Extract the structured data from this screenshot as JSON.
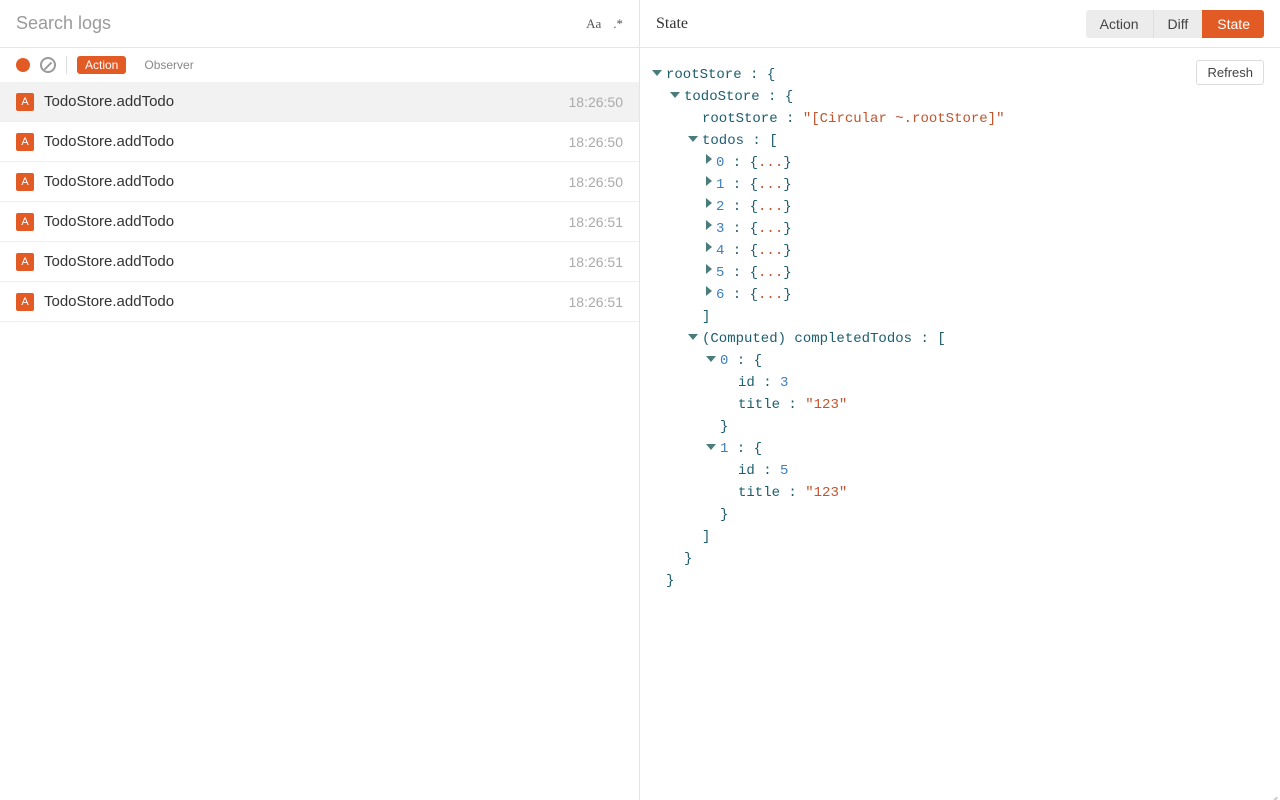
{
  "search": {
    "placeholder": "Search logs",
    "matchCaseLabel": "Aa",
    "regexLabel": ".*"
  },
  "filters": {
    "action": "Action",
    "observer": "Observer"
  },
  "logs": [
    {
      "badge": "A",
      "name": "TodoStore.addTodo",
      "time": "18:26:50",
      "selected": true
    },
    {
      "badge": "A",
      "name": "TodoStore.addTodo",
      "time": "18:26:50",
      "selected": false
    },
    {
      "badge": "A",
      "name": "TodoStore.addTodo",
      "time": "18:26:50",
      "selected": false
    },
    {
      "badge": "A",
      "name": "TodoStore.addTodo",
      "time": "18:26:51",
      "selected": false
    },
    {
      "badge": "A",
      "name": "TodoStore.addTodo",
      "time": "18:26:51",
      "selected": false
    },
    {
      "badge": "A",
      "name": "TodoStore.addTodo",
      "time": "18:26:51",
      "selected": false
    }
  ],
  "rightPanel": {
    "title": "State",
    "tabs": {
      "action": "Action",
      "diff": "Diff",
      "state": "State"
    },
    "refresh": "Refresh"
  },
  "tree": {
    "rootLabel": "rootStore",
    "todoStoreLabel": "todoStore",
    "circularKey": "rootStore",
    "circularValue": "\"[Circular ~.rootStore]\"",
    "todosLabel": "todos",
    "todosIndices": [
      "0",
      "1",
      "2",
      "3",
      "4",
      "5",
      "6"
    ],
    "dots": "...",
    "computedLabel": "(Computed) completedTodos",
    "completed": [
      {
        "index": "0",
        "idKey": "id",
        "idVal": "3",
        "titleKey": "title",
        "titleVal": "\"123\""
      },
      {
        "index": "1",
        "idKey": "id",
        "idVal": "5",
        "titleKey": "title",
        "titleVal": "\"123\""
      }
    ],
    "colon": " : ",
    "openBrace": "{",
    "closeBrace": "}",
    "openBracket": "[",
    "closeBracket": "]"
  }
}
